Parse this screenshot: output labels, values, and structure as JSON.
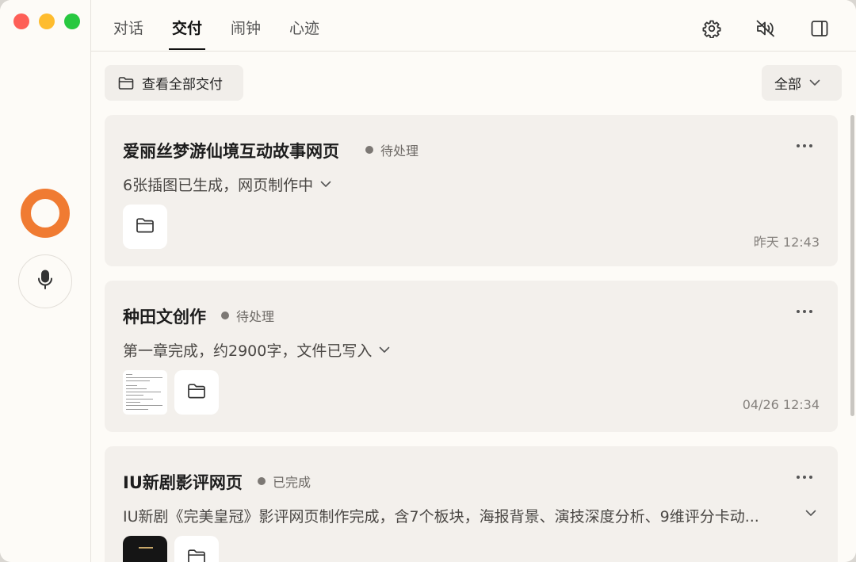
{
  "window": {
    "traffic_lights": [
      "close",
      "minimize",
      "zoom"
    ]
  },
  "rail": {
    "orb_color": "#f07b32",
    "mic_icon": "microphone-icon"
  },
  "tabs": [
    {
      "label": "对话",
      "active": false
    },
    {
      "label": "交付",
      "active": true
    },
    {
      "label": "闹钟",
      "active": false
    },
    {
      "label": "心迹",
      "active": false
    }
  ],
  "toolbar": {
    "icons": [
      "gear-icon",
      "speaker-muted-icon",
      "sidebar-toggle-icon"
    ]
  },
  "actions": {
    "view_all": "查看全部交付",
    "filter": "全部"
  },
  "cards": [
    {
      "title": "爱丽丝梦游仙境互动故事网页",
      "status": "待处理",
      "summary": "6张插图已生成，网页制作中",
      "time": "昨天 12:43"
    },
    {
      "title": "种田文创作",
      "status": "待处理",
      "summary": "第一章完成，约2900字，文件已写入",
      "time": "04/26 12:34"
    },
    {
      "title": "IU新剧影评网页",
      "status": "已完成",
      "summary": "IU新剧《完美皇冠》影评网页制作完成，含7个板块，海报背景、演技深度分析、9维评分卡动..."
    }
  ]
}
